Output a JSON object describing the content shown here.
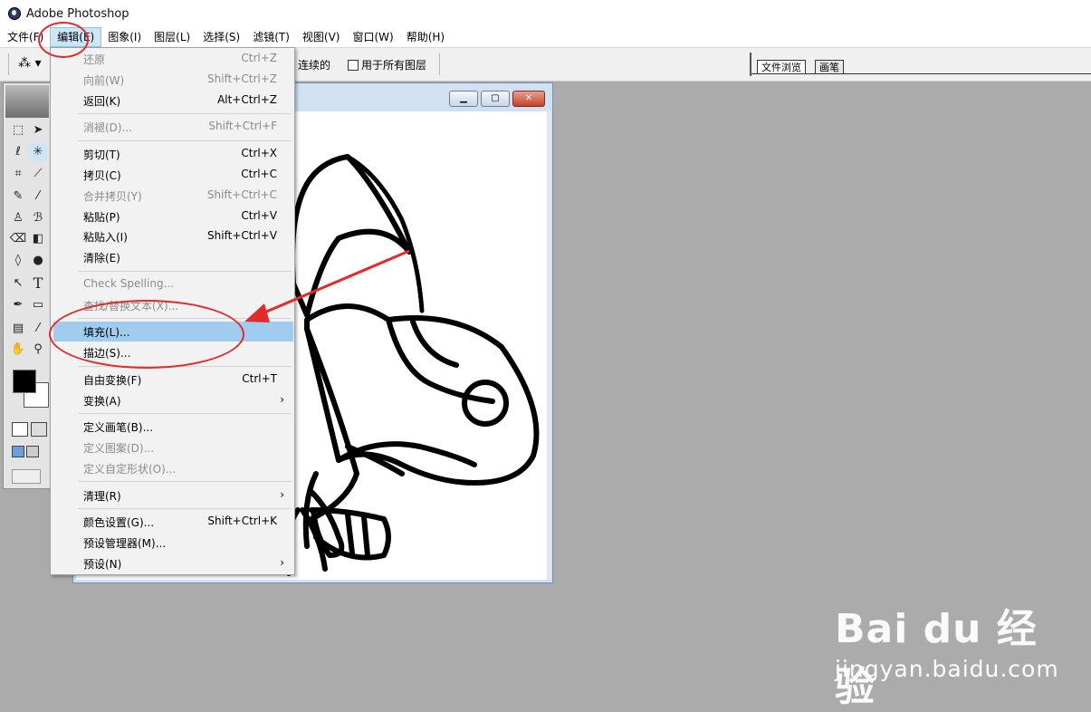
{
  "window": {
    "title": "Adobe Photoshop"
  },
  "menubar": {
    "items": [
      "文件(F)",
      "编辑(E)",
      "图象(I)",
      "图层(L)",
      "选择(S)",
      "滤镜(T)",
      "视图(V)",
      "窗口(W)",
      "帮助(H)"
    ],
    "active_index": 1
  },
  "options": {
    "contiguous_label": "连续的",
    "all_layers_label": "用于所有图层"
  },
  "palette_well": {
    "tabs": [
      "文件浏览",
      "画笔"
    ]
  },
  "edit_menu": {
    "items": [
      {
        "label": "还原",
        "shortcut": "Ctrl+Z",
        "enabled": false
      },
      {
        "label": "向前(W)",
        "shortcut": "Shift+Ctrl+Z",
        "enabled": false
      },
      {
        "label": "返回(K)",
        "shortcut": "Alt+Ctrl+Z",
        "enabled": true
      },
      {
        "label": "消褪(D)...",
        "shortcut": "Shift+Ctrl+F",
        "enabled": false
      },
      {
        "label": "剪切(T)",
        "shortcut": "Ctrl+X",
        "enabled": true
      },
      {
        "label": "拷贝(C)",
        "shortcut": "Ctrl+C",
        "enabled": true
      },
      {
        "label": "合并拷贝(Y)",
        "shortcut": "Shift+Ctrl+C",
        "enabled": false
      },
      {
        "label": "粘贴(P)",
        "shortcut": "Ctrl+V",
        "enabled": true
      },
      {
        "label": "粘贴入(I)",
        "shortcut": "Shift+Ctrl+V",
        "enabled": true
      },
      {
        "label": "清除(E)",
        "shortcut": "",
        "enabled": true
      },
      {
        "label": "Check Spelling...",
        "shortcut": "",
        "enabled": false
      },
      {
        "label": "查找/替换文本(X)...",
        "shortcut": "",
        "enabled": false
      },
      {
        "label": "填充(L)...",
        "shortcut": "",
        "enabled": true,
        "highlighted": true
      },
      {
        "label": "描边(S)...",
        "shortcut": "",
        "enabled": true
      },
      {
        "label": "自由变换(F)",
        "shortcut": "Ctrl+T",
        "enabled": true
      },
      {
        "label": "变换(A)",
        "shortcut": "",
        "enabled": true,
        "submenu": true
      },
      {
        "label": "定义画笔(B)...",
        "shortcut": "",
        "enabled": true
      },
      {
        "label": "定义图案(D)...",
        "shortcut": "",
        "enabled": false
      },
      {
        "label": "定义自定形状(O)...",
        "shortcut": "",
        "enabled": false
      },
      {
        "label": "清理(R)",
        "shortcut": "",
        "enabled": true,
        "submenu": true
      },
      {
        "label": "颜色设置(G)...",
        "shortcut": "Shift+Ctrl+K",
        "enabled": true
      },
      {
        "label": "预设管理器(M)...",
        "shortcut": "",
        "enabled": true
      },
      {
        "label": "预设(N)",
        "shortcut": "",
        "enabled": true,
        "submenu": true
      }
    ],
    "submenu_glyph": "›"
  },
  "document_window": {
    "buttons": [
      "minimize-icon",
      "restore-icon",
      "close-icon"
    ]
  },
  "toolbox": {
    "tools": [
      "marquee",
      "move",
      "lasso",
      "magic-wand",
      "crop",
      "slice",
      "healing",
      "brush",
      "stamp",
      "history-brush",
      "eraser",
      "gradient",
      "blur",
      "dodge",
      "path-select",
      "type",
      "pen",
      "shape",
      "notes",
      "eyedropper",
      "hand",
      "zoom"
    ],
    "foreground_color": "#000000",
    "background_color": "#ffffff"
  },
  "watermark": {
    "logo": "Bai du 经验",
    "url": "jingyan.baidu.com"
  },
  "colors": {
    "annotation": "#e32b2b",
    "highlight": "#9fccef",
    "workspace": "#ababab"
  }
}
